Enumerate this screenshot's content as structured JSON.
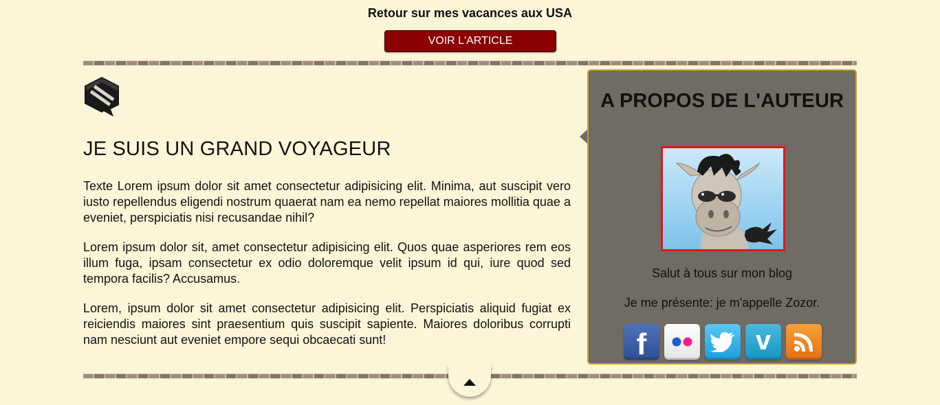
{
  "banner": {
    "title": "Retour sur mes vacances aux USA",
    "button_label": "VOIR L'ARTICLE"
  },
  "article": {
    "logo_icon": "comment-icon",
    "title": "JE SUIS UN GRAND VOYAGEUR",
    "paragraphs": [
      "Texte Lorem ipsum dolor sit amet consectetur adipisicing elit. Minima, aut suscipit vero iusto repellendus eligendi nostrum quaerat nam ea nemo repellat maiores mollitia quae a eveniet, perspiciatis nisi recusandae nihil?",
      "Lorem ipsum dolor sit, amet consectetur adipisicing elit. Quos quae asperiores rem eos illum fuga, ipsam consectetur ex odio doloremque velit ipsum id qui, iure quod sed tempora facilis? Accusamus.",
      "Lorem, ipsum dolor sit amet consectetur adipisicing elit. Perspiciatis aliquid fugiat ex reiciendis maiores sint praesentium quis suscipit sapiente. Maiores doloribus corrupti nam nesciunt aut eveniet empore sequi obcaecati sunt!"
    ]
  },
  "aside": {
    "title": "A PROPOS DE L'AUTEUR",
    "avatar": "zozor-avatar",
    "lines": [
      "Salut à tous sur mon blog",
      "Je me présente: je m'appelle Zozor."
    ],
    "socials": [
      {
        "name": "facebook",
        "glyph": "f"
      },
      {
        "name": "flickr",
        "glyph": ""
      },
      {
        "name": "twitter",
        "glyph": ""
      },
      {
        "name": "vimeo",
        "glyph": "v"
      },
      {
        "name": "rss",
        "glyph": ""
      }
    ]
  },
  "footer": {
    "back_to_top_icon": "arrow-up-icon"
  },
  "colors": {
    "page_bg": "#fdf5d8",
    "button_bg": "#8b0000",
    "aside_bg": "#706b64",
    "aside_border": "#c7a22b",
    "avatar_border": "#e01818"
  }
}
